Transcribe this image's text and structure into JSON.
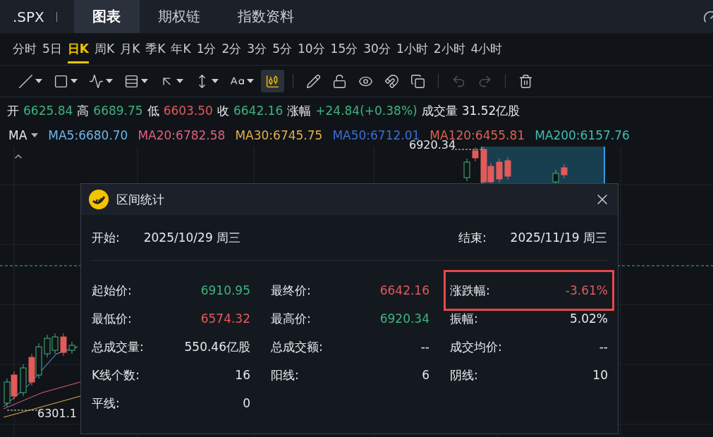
{
  "header": {
    "symbol": ".SPX",
    "tabs": [
      {
        "label": "图表",
        "selected": true
      },
      {
        "label": "期权链",
        "selected": false
      },
      {
        "label": "指数资料",
        "selected": false
      }
    ]
  },
  "periods": [
    {
      "label": "分时",
      "selected": false
    },
    {
      "label": "5日",
      "selected": false
    },
    {
      "label": "日K",
      "selected": true
    },
    {
      "label": "周K",
      "selected": false
    },
    {
      "label": "月K",
      "selected": false
    },
    {
      "label": "季K",
      "selected": false
    },
    {
      "label": "年K",
      "selected": false
    },
    {
      "label": "1分",
      "selected": false
    },
    {
      "label": "2分",
      "selected": false
    },
    {
      "label": "3分",
      "selected": false
    },
    {
      "label": "5分",
      "selected": false
    },
    {
      "label": "10分",
      "selected": false
    },
    {
      "label": "15分",
      "selected": false
    },
    {
      "label": "30分",
      "selected": false
    },
    {
      "label": "1小时",
      "selected": false
    },
    {
      "label": "2小时",
      "selected": false
    },
    {
      "label": "4小时",
      "selected": false
    }
  ],
  "tools": [
    {
      "kind": "line",
      "selected": false,
      "disabled": false
    },
    {
      "kind": "rect",
      "selected": false,
      "disabled": false
    },
    {
      "kind": "wave",
      "selected": false,
      "disabled": false
    },
    {
      "kind": "fib",
      "selected": false,
      "disabled": false
    },
    {
      "kind": "arrow",
      "selected": false,
      "disabled": false
    },
    {
      "kind": "range",
      "selected": false,
      "disabled": false
    },
    {
      "kind": "text",
      "selected": false,
      "disabled": false
    },
    {
      "kind": "stats",
      "selected": true,
      "disabled": false
    },
    {
      "kind": "pen",
      "selected": false,
      "disabled": false
    },
    {
      "kind": "lock",
      "selected": false,
      "disabled": false
    },
    {
      "kind": "eye",
      "selected": false,
      "disabled": false
    },
    {
      "kind": "magnet",
      "selected": false,
      "disabled": false
    },
    {
      "kind": "copy",
      "selected": false,
      "disabled": false
    },
    {
      "kind": "undo",
      "selected": false,
      "disabled": true
    },
    {
      "kind": "redo",
      "selected": false,
      "disabled": true
    },
    {
      "kind": "trash",
      "selected": false,
      "disabled": false
    }
  ],
  "quote": [
    {
      "label": "开",
      "value": "6625.84",
      "color": "#3fb37f"
    },
    {
      "label": "高",
      "value": "6689.75",
      "color": "#3fb37f"
    },
    {
      "label": "低",
      "value": "6603.50",
      "color": "#e35a5a"
    },
    {
      "label": "收",
      "value": "6642.16",
      "color": "#3fb37f"
    },
    {
      "label": "涨幅",
      "value": "+24.84(+0.38%)",
      "color": "#3fb37f"
    },
    {
      "label": "成交量",
      "value": "31.52亿股",
      "color": "#e6e8eb"
    }
  ],
  "ma": {
    "label": "MA",
    "lines": [
      {
        "text": "MA5:6680.70",
        "color": "#6fb6e8"
      },
      {
        "text": "MA20:6782.58",
        "color": "#e0607a"
      },
      {
        "text": "MA30:6745.75",
        "color": "#e3b04b"
      },
      {
        "text": "MA50:6712.01",
        "color": "#3a6ed8"
      },
      {
        "text": "MA120:6455.81",
        "color": "#e06050"
      },
      {
        "text": "MA200:6157.76",
        "color": "#3fbfb0"
      }
    ]
  },
  "chart": {
    "high_label": "6920.34",
    "low_label": "6301.1"
  },
  "dialog": {
    "title": "区间统计",
    "start": {
      "label": "开始:",
      "value": "2025/10/29 周三"
    },
    "end": {
      "label": "结束:",
      "value": "2025/11/19 周三"
    },
    "stats": [
      {
        "label": "起始价:",
        "value": "6910.95",
        "color": "#3fb37f",
        "highlighted": false
      },
      {
        "label": "最终价:",
        "value": "6642.16",
        "color": "#e35a5a",
        "highlighted": false
      },
      {
        "label": "涨跌幅:",
        "value": "-3.61%",
        "color": "#e35a5a",
        "highlighted": true
      },
      {
        "label": "最低价:",
        "value": "6574.32",
        "color": "#e35a5a",
        "highlighted": false
      },
      {
        "label": "最高价:",
        "value": "6920.34",
        "color": "#3fb37f",
        "highlighted": false
      },
      {
        "label": "振幅:",
        "value": "5.02%",
        "color": "#e6e8eb",
        "highlighted": false
      },
      {
        "label": "总成交量:",
        "value": "550.46亿股",
        "color": "#e6e8eb",
        "highlighted": false
      },
      {
        "label": "总成交额:",
        "value": "--",
        "color": "#e6e8eb",
        "highlighted": false
      },
      {
        "label": "成交均价:",
        "value": "--",
        "color": "#e6e8eb",
        "highlighted": false
      },
      {
        "label": "K线个数:",
        "value": "16",
        "color": "#e6e8eb",
        "highlighted": false
      },
      {
        "label": "阳线:",
        "value": "6",
        "color": "#e6e8eb",
        "highlighted": false
      },
      {
        "label": "阴线:",
        "value": "10",
        "color": "#e6e8eb",
        "highlighted": false
      },
      {
        "label": "平线:",
        "value": "0",
        "color": "#e6e8eb",
        "highlighted": false
      }
    ]
  }
}
